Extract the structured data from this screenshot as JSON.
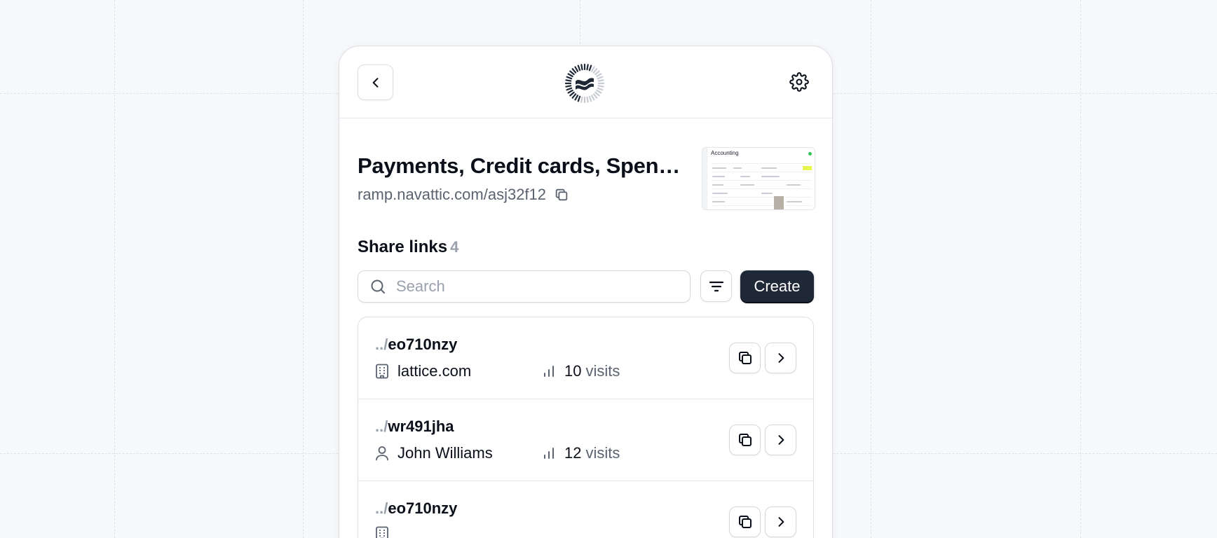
{
  "header": {
    "back_icon": "chevron-left-icon",
    "logo_icon": "navattic-logo-icon",
    "settings_icon": "gear-icon"
  },
  "demo": {
    "title": "Payments, Credit cards, Spen…",
    "url": "ramp.navattic.com/asj32f12",
    "thumbnail_title": "Accounting"
  },
  "share": {
    "title": "Share links",
    "count": "4",
    "search_placeholder": "Search",
    "create_label": "Create"
  },
  "links": [
    {
      "prefix": "../",
      "slug": "eo710nzy",
      "who": "lattice.com",
      "who_icon": "building-icon",
      "visits": "10",
      "visits_label": "visits"
    },
    {
      "prefix": "../",
      "slug": "wr491jha",
      "who": "John Williams",
      "who_icon": "user-icon",
      "visits": "12",
      "visits_label": "visits"
    },
    {
      "prefix": "../",
      "slug": "eo710nzy",
      "who": "",
      "who_icon": "building-icon",
      "visits": "",
      "visits_label": ""
    }
  ],
  "colors": {
    "background": "#f7f8fa",
    "primary_button": "#1e2836",
    "muted_text": "#9aa1ad",
    "secondary_text": "#5b6270"
  }
}
